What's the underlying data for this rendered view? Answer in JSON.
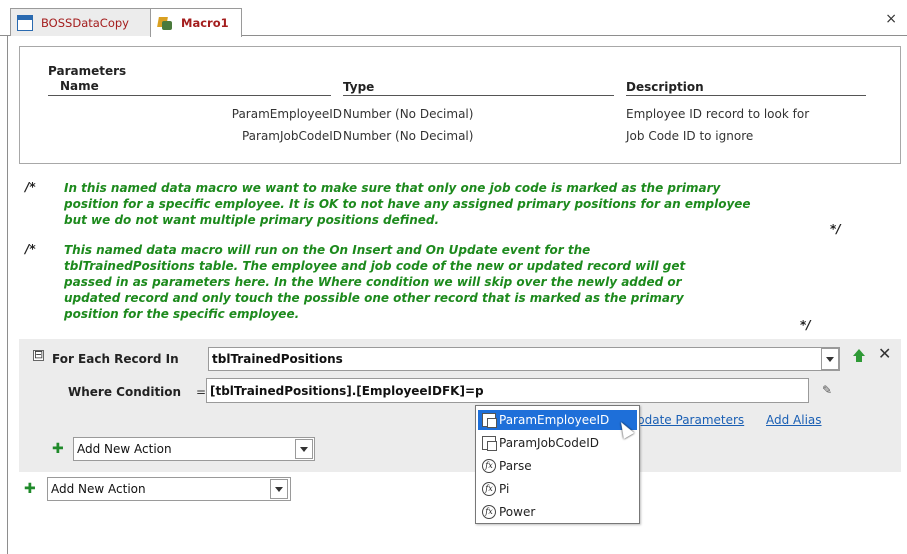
{
  "tabs": [
    {
      "label": "BOSSDataCopy",
      "icon": "table-icon",
      "active": false
    },
    {
      "label": "Macro1",
      "icon": "macro-icon",
      "active": true
    }
  ],
  "close_glyph": "×",
  "parameters": {
    "section_title": "Parameters",
    "headers": {
      "name": "Name",
      "type": "Type",
      "description": "Description"
    },
    "rows": [
      {
        "name": "ParamEmployeeID",
        "type": "Number (No Decimal)",
        "description": "Employee ID record to look for"
      },
      {
        "name": "ParamJobCodeID",
        "type": "Number (No Decimal)",
        "description": "Job Code ID to ignore"
      }
    ]
  },
  "comments": [
    {
      "open": "/*",
      "close": "*/",
      "lines": [
        "In this named data macro we want to make sure that only one job code is marked as the primary",
        "position for a specific employee. It is OK to not have any assigned primary positions for an employee",
        "but we do not want multiple primary positions defined."
      ]
    },
    {
      "open": "/*",
      "close": "*/",
      "lines": [
        "This named data macro will run on the On Insert and On Update event for the",
        "tblTrainedPositions table. The employee and job code of the new or updated record will get",
        "passed in as parameters here. In the Where condition we will skip over the newly added or",
        "updated record and only touch the possible one other record that is marked as the primary",
        "position for the specific employee."
      ]
    }
  ],
  "for_each": {
    "label": "For Each Record In",
    "collapse_glyph": "⊟",
    "table_value": "tblTrainedPositions",
    "where_label": "Where Condition",
    "equals": "=",
    "where_value": "[tblTrainedPositions].[EmployeeIDFK]=p",
    "update_parameters_link": "pdate Parameters",
    "add_alias_link": "Add Alias",
    "add_new_action_inner": "Add New Action",
    "plus_glyph": "✚",
    "x_glyph": "✕",
    "builder_glyph": "✎"
  },
  "add_new_action_outer": "Add New Action",
  "autocomplete": {
    "items": [
      {
        "label": "ParamEmployeeID",
        "icon": "parameter-icon",
        "selected": true
      },
      {
        "label": "ParamJobCodeID",
        "icon": "parameter-icon",
        "selected": false
      },
      {
        "label": "Parse",
        "icon": "function-icon",
        "selected": false
      },
      {
        "label": "Pi",
        "icon": "function-icon",
        "selected": false
      },
      {
        "label": "Power",
        "icon": "function-icon",
        "selected": false
      }
    ],
    "fx_glyph": "fx"
  },
  "colors": {
    "comment_green": "#1d8a1d",
    "selection_blue": "#1e6fd9",
    "link_blue": "#1a5fb4",
    "block_gray": "#ececec"
  }
}
